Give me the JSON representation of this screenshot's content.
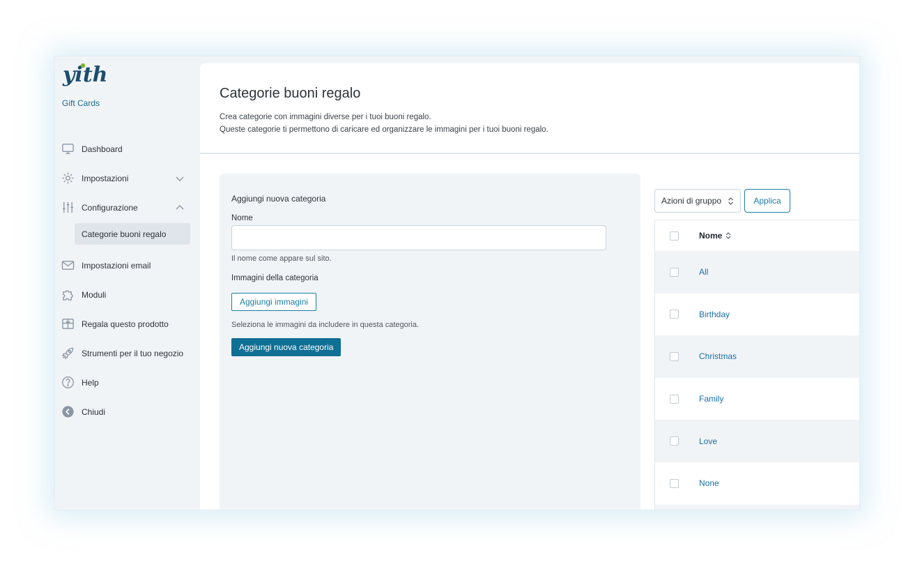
{
  "app": {
    "brand_name": "Gift Cards",
    "logo_text": "yith",
    "logo_color": "#1b4d6e",
    "logo_accent": "#7ab829"
  },
  "sidebar": {
    "items": [
      {
        "label": "Dashboard",
        "icon": "monitor-icon"
      },
      {
        "label": "Impostazioni",
        "icon": "gear-icon",
        "chevron": "down"
      },
      {
        "label": "Configurazione",
        "icon": "sliders-icon",
        "chevron": "up"
      },
      {
        "label": "Categorie buoni regalo",
        "sub": true,
        "active": true
      },
      {
        "label": "Impostazioni email",
        "icon": "mail-icon"
      },
      {
        "label": "Moduli",
        "icon": "puzzle-icon"
      },
      {
        "label": "Regala questo prodotto",
        "icon": "gift-icon"
      },
      {
        "label": "Strumenti per il tuo negozio",
        "icon": "rocket-icon"
      },
      {
        "label": "Help",
        "icon": "help-icon"
      },
      {
        "label": "Chiudi",
        "icon": "arrow-left-circle-icon"
      }
    ]
  },
  "header": {
    "title": "Categorie buoni regalo",
    "desc_line1": "Crea categorie con immagini diverse per i tuoi buoni regalo.",
    "desc_line2": "Queste categorie ti permettono di caricare ed organizzare le immagini per i tuoi buoni regalo."
  },
  "form": {
    "title": "Aggiungi nuova categoria",
    "name_label": "Nome",
    "name_value": "",
    "name_hint": "Il nome come appare sul sito.",
    "images_label": "Immagini della categoria",
    "add_images_button": "Aggiungi immagini",
    "images_hint": "Seleziona le immagini da includere in questa categoria.",
    "submit_button": "Aggiungi nuova categoria"
  },
  "table": {
    "bulk_actions_label": "Azioni di gruppo",
    "apply_button": "Applica",
    "column_name": "Nome",
    "rows": [
      "All",
      "Birthday",
      "Christmas",
      "Family",
      "Love",
      "None"
    ]
  },
  "colors": {
    "primary": "#0f6f94",
    "link": "#1a6fa8",
    "sidebar_bg": "#f1f4f7"
  }
}
